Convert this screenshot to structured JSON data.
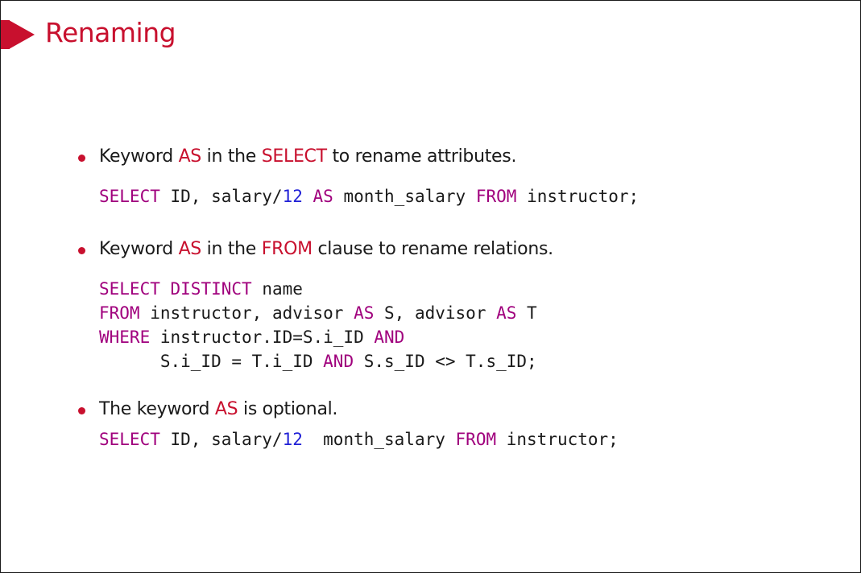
{
  "title": "Renaming",
  "bullets": [
    {
      "parts": [
        "Keyword ",
        "AS",
        " in the ",
        "SELECT",
        " to rename attributes."
      ],
      "code": [
        [
          {
            "t": "SELECT",
            "k": "kw"
          },
          {
            "t": " ID, salary/"
          },
          {
            "t": "12",
            "k": "num"
          },
          {
            "t": " "
          },
          {
            "t": "AS",
            "k": "kw"
          },
          {
            "t": " month_salary "
          },
          {
            "t": "FROM",
            "k": "kw"
          },
          {
            "t": " instructor;"
          }
        ]
      ]
    },
    {
      "parts": [
        "Keyword ",
        "AS",
        " in the ",
        "FROM",
        " clause to rename relations."
      ],
      "code": [
        [
          {
            "t": "SELECT",
            "k": "kw"
          },
          {
            "t": " "
          },
          {
            "t": "DISTINCT",
            "k": "kw"
          },
          {
            "t": " name"
          }
        ],
        [
          {
            "t": "FROM",
            "k": "kw"
          },
          {
            "t": " instructor, advisor "
          },
          {
            "t": "AS",
            "k": "kw"
          },
          {
            "t": " S, advisor "
          },
          {
            "t": "AS",
            "k": "kw"
          },
          {
            "t": " T"
          }
        ],
        [
          {
            "t": "WHERE",
            "k": "kw"
          },
          {
            "t": " instructor.ID=S.i_ID "
          },
          {
            "t": "AND",
            "k": "kw"
          }
        ],
        [
          {
            "t": "      S.i_ID = T.i_ID "
          },
          {
            "t": "AND",
            "k": "kw"
          },
          {
            "t": " S.s_ID <> T.s_ID;"
          }
        ]
      ]
    },
    {
      "parts": [
        "The keyword ",
        "AS",
        " is optional."
      ],
      "code": [
        [
          {
            "t": "SELECT",
            "k": "kw"
          },
          {
            "t": " ID, salary/"
          },
          {
            "t": "12",
            "k": "num"
          },
          {
            "t": "  month_salary "
          },
          {
            "t": "FROM",
            "k": "kw"
          },
          {
            "t": " instructor;"
          }
        ]
      ]
    }
  ]
}
